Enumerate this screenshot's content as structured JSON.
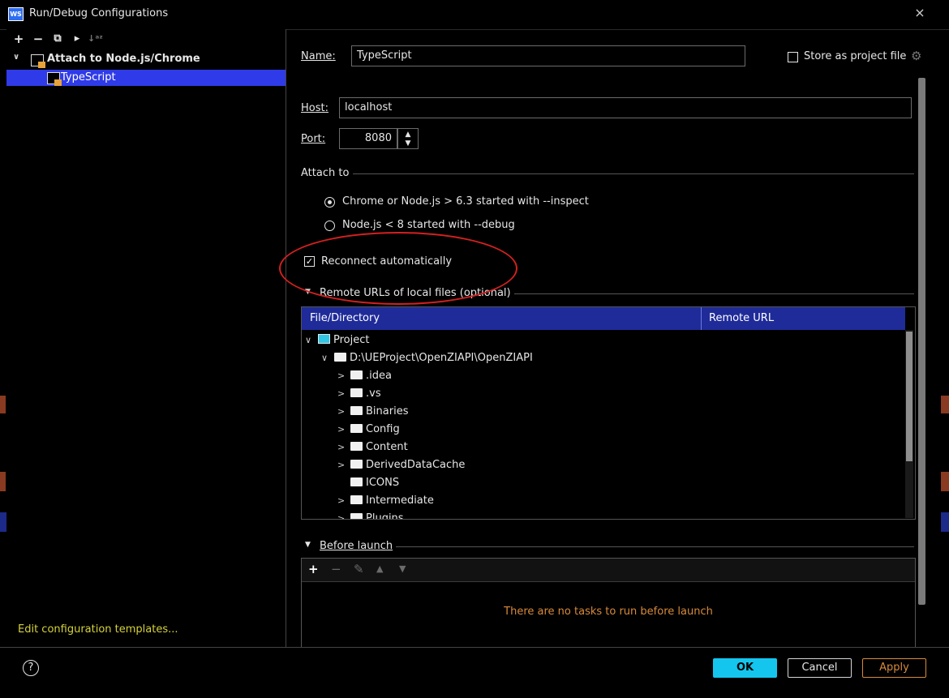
{
  "window": {
    "title": "Run/Debug Configurations",
    "logo": "WS",
    "close_glyph": "×"
  },
  "toolbar": {
    "add": "+",
    "remove": "−",
    "copy": "⧉",
    "move": "▸",
    "sort": "↓ᵃᶻ"
  },
  "tree": {
    "parent_label": "Attach to Node.js/Chrome",
    "child_label": "TypeScript",
    "expand_glyph": "∨"
  },
  "edit_templates_link": "Edit configuration templates...",
  "form": {
    "name_label": "Name:",
    "name_value": "TypeScript",
    "store_label": "Store as project file",
    "host_label": "Host:",
    "host_value": "localhost",
    "port_label": "Port:",
    "port_value": "8080",
    "attach_to_label": "Attach to",
    "radio_inspect": "Chrome or Node.js > 6.3 started with --inspect",
    "radio_debug": "Node.js < 8 started with --debug",
    "reconnect_label": "Reconnect automatically",
    "remote_urls_label": "Remote URLs of local files (optional)"
  },
  "table": {
    "col_file": "File/Directory",
    "col_remote": "Remote URL",
    "rows": [
      {
        "label": "Project",
        "indent": 0,
        "chev": "∨",
        "icon": "project"
      },
      {
        "label": "D:\\UEProject\\OpenZIAPI\\OpenZIAPI",
        "indent": 1,
        "chev": "∨",
        "icon": "folder"
      },
      {
        "label": ".idea",
        "indent": 2,
        "chev": ">",
        "icon": "folder"
      },
      {
        "label": ".vs",
        "indent": 2,
        "chev": ">",
        "icon": "folder"
      },
      {
        "label": "Binaries",
        "indent": 2,
        "chev": ">",
        "icon": "folder"
      },
      {
        "label": "Config",
        "indent": 2,
        "chev": ">",
        "icon": "folder"
      },
      {
        "label": "Content",
        "indent": 2,
        "chev": ">",
        "icon": "folder"
      },
      {
        "label": "DerivedDataCache",
        "indent": 2,
        "chev": ">",
        "icon": "folder"
      },
      {
        "label": "ICONS",
        "indent": 2,
        "chev": "",
        "icon": "folder"
      },
      {
        "label": "Intermediate",
        "indent": 2,
        "chev": ">",
        "icon": "folder"
      },
      {
        "label": "Plugins",
        "indent": 2,
        "chev": ">",
        "icon": "folder"
      }
    ]
  },
  "before_launch": {
    "label": "Before launch",
    "empty_text": "There are no tasks to run before launch",
    "icons": [
      "+",
      "−",
      "✎",
      "▲",
      "▼"
    ]
  },
  "buttons": {
    "help": "?",
    "ok": "OK",
    "cancel": "Cancel",
    "apply": "Apply"
  },
  "colors": {
    "accent": "#14c6ee",
    "selection": "#2f3be8",
    "link": "#d6d23a",
    "warning": "#d88a3a",
    "highlight_circle": "#d42020"
  }
}
